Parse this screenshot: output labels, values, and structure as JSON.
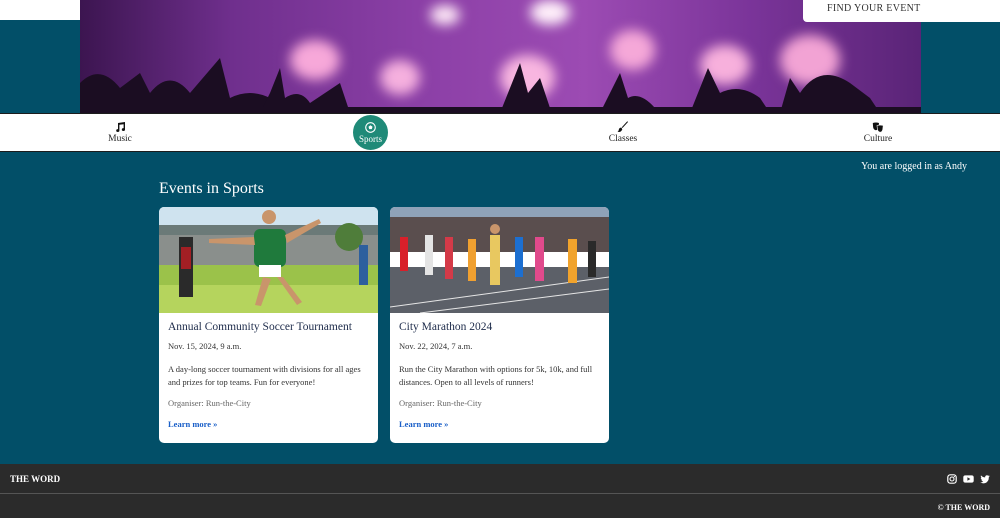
{
  "header": {
    "find_event_label": "FIND YOUR EVENT"
  },
  "categories": [
    {
      "label": "Music",
      "icon": "music-note-icon"
    },
    {
      "label": "Sports",
      "icon": "soccer-ball-icon"
    },
    {
      "label": "Classes",
      "icon": "paintbrush-icon"
    },
    {
      "label": "Culture",
      "icon": "theater-masks-icon"
    }
  ],
  "active_category": "Sports",
  "login_status": "You are logged in as Andy",
  "section_title": "Events in Sports",
  "events": [
    {
      "title": "Annual Community Soccer Tournament",
      "date": "Nov. 15, 2024, 9 a.m.",
      "description": "A day-long soccer tournament with divisions for all ages and prizes for top teams. Fun for everyone!",
      "organiser": "Organiser: Run-the-City",
      "link_label": "Learn more »",
      "image": "soccer-player-celebrating"
    },
    {
      "title": "City Marathon 2024",
      "date": "Nov. 22, 2024, 7 a.m.",
      "description": "Run the City Marathon with options for 5k, 10k, and full distances. Open to all levels of runners!",
      "organiser": "Organiser: Run-the-City",
      "link_label": "Learn more »",
      "image": "marathon-runners"
    }
  ],
  "footer": {
    "brand": "THE WORD",
    "copyright": "© THE WORD",
    "social_icons": [
      "instagram-icon",
      "youtube-icon",
      "twitter-icon"
    ]
  },
  "colors": {
    "background": "#024f68",
    "accent": "#1f8a78",
    "footer": "#2b2b2b",
    "link": "#1a5fc8"
  }
}
